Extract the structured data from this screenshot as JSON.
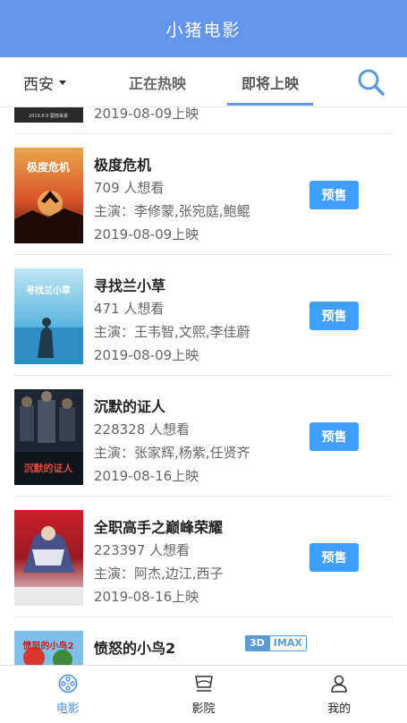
{
  "header": {
    "title": "小猪电影"
  },
  "nav": {
    "city": "西安",
    "tabs": [
      {
        "label": "正在热映"
      },
      {
        "label": "即将上映"
      }
    ]
  },
  "list": {
    "partial_top": {
      "date": "2019-08-09上映",
      "poster_caption": "2019.8.9 震撼来袭"
    },
    "movies": [
      {
        "title": "极度危机",
        "wish": "709 人想看",
        "cast": "主演：李修蒙,张宛庭,鲍鲲",
        "date": "2019-08-09上映",
        "button": "预售",
        "poster_title": "极度危机"
      },
      {
        "title": "寻找兰小草",
        "wish": "471 人想看",
        "cast": "主演：王韦智,文熙,李佳蔚",
        "date": "2019-08-09上映",
        "button": "预售",
        "poster_title": "寻找兰小草"
      },
      {
        "title": "沉默的证人",
        "wish": "228328 人想看",
        "cast": "主演：张家辉,杨紫,任贤齐",
        "date": "2019-08-16上映",
        "button": "预售",
        "poster_title": "沉默的证人"
      },
      {
        "title": "全职高手之巅峰荣耀",
        "wish": "223397 人想看",
        "cast": "主演：阿杰,边江,西子",
        "date": "2019-08-16上映",
        "button": "预售"
      }
    ],
    "partial_bottom": {
      "title": "愤怒的小鸟2",
      "badge_3d": "3D",
      "badge_imax": "IMAX",
      "poster_title": "愤怒的小鸟2"
    }
  },
  "tabbar": {
    "items": [
      {
        "label": "电影"
      },
      {
        "label": "影院"
      },
      {
        "label": "我的"
      }
    ]
  },
  "colors": {
    "header": "#6495ed",
    "button": "#409eff",
    "active_tab": "#4a90e2"
  }
}
